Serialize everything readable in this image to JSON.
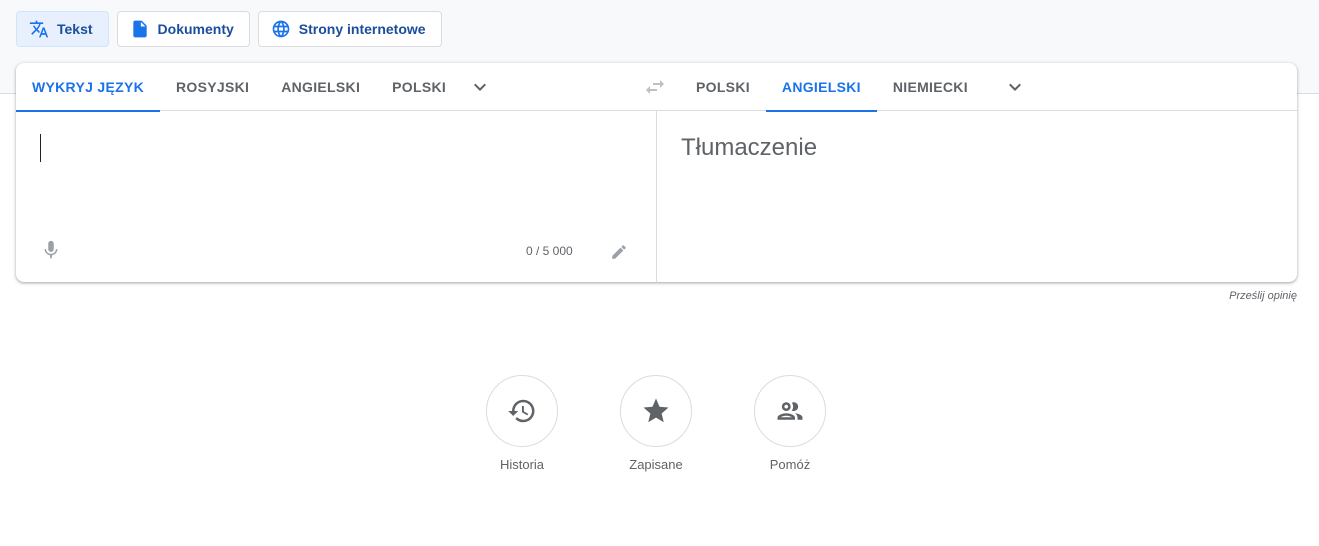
{
  "modes": {
    "text": "Tekst",
    "documents": "Dokumenty",
    "websites": "Strony internetowe"
  },
  "source_tabs": [
    "WYKRYJ JĘZYK",
    "ROSYJSKI",
    "ANGIELSKI",
    "POLSKI"
  ],
  "target_tabs": [
    "POLSKI",
    "ANGIELSKI",
    "NIEMIECKI"
  ],
  "source_active_index": 0,
  "target_active_index": 1,
  "input": {
    "value": ""
  },
  "char_count": "0 / 5 000",
  "translation_placeholder": "Tłumaczenie",
  "feedback_link": "Prześlij opinię",
  "actions": {
    "history": "Historia",
    "saved": "Zapisane",
    "contribute": "Pomóż"
  },
  "colors": {
    "accent": "#1a73e8",
    "muted": "#5f6368",
    "border": "#dadce0"
  },
  "icons": [
    "translate-icon",
    "document-icon",
    "globe-icon",
    "chevron-down-icon",
    "swap-icon",
    "mic-icon",
    "pencil-icon",
    "history-icon",
    "star-icon",
    "people-icon"
  ]
}
